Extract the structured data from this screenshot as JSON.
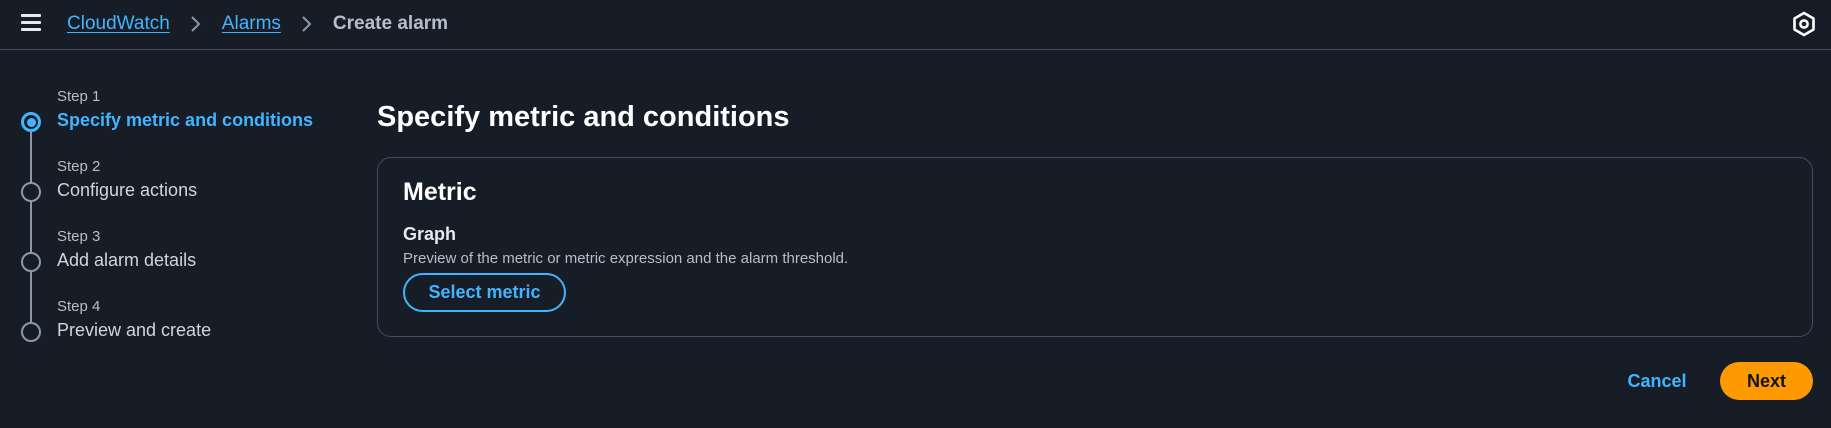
{
  "header": {
    "menu_icon": "hamburger-menu-icon",
    "breadcrumbs": [
      {
        "label": "CloudWatch"
      },
      {
        "label": "Alarms"
      },
      {
        "label": "Create alarm"
      }
    ],
    "settings_icon": "settings-icon"
  },
  "steps": [
    {
      "number": "Step 1",
      "title": "Specify metric and conditions",
      "active": true
    },
    {
      "number": "Step 2",
      "title": "Configure actions",
      "active": false
    },
    {
      "number": "Step 3",
      "title": "Add alarm details",
      "active": false
    },
    {
      "number": "Step 4",
      "title": "Preview and create",
      "active": false
    }
  ],
  "main": {
    "title": "Specify metric and conditions",
    "panel": {
      "title": "Metric",
      "field_label": "Graph",
      "field_description": "Preview of the metric or metric expression and the alarm threshold.",
      "select_button": "Select metric"
    }
  },
  "footer": {
    "cancel_label": "Cancel",
    "next_label": "Next"
  },
  "colors": {
    "background": "#161d26",
    "link": "#42b4ff",
    "primary_button": "#ff9900",
    "border": "#414d5c"
  }
}
